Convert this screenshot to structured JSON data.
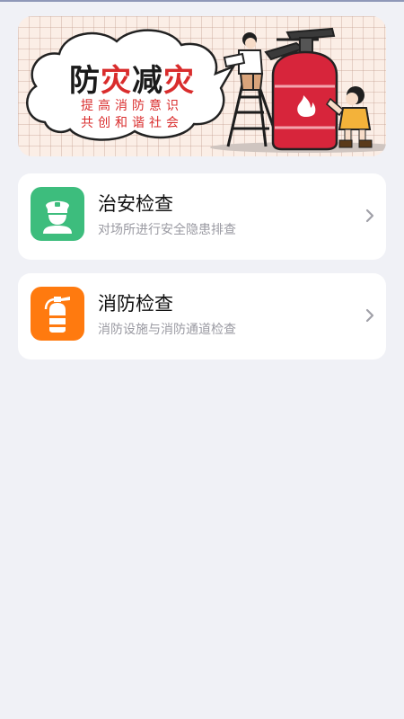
{
  "banner": {
    "title_part1": "防",
    "title_part2": "灾",
    "title_part3": "减",
    "title_part4": "灾",
    "subtitle_line1": "提高消防意识",
    "subtitle_line2": "共创和谐社会"
  },
  "cards": [
    {
      "title": "治安检查",
      "description": "对场所进行安全隐患排查",
      "icon": "police-officer-icon",
      "icon_color": "#3dbd7d"
    },
    {
      "title": "消防检查",
      "description": "消防设施与消防通道检查",
      "icon": "fire-extinguisher-icon",
      "icon_color": "#ff7a0f"
    }
  ],
  "colors": {
    "background": "#f0f1f6",
    "accent_red": "#d92c2c"
  }
}
